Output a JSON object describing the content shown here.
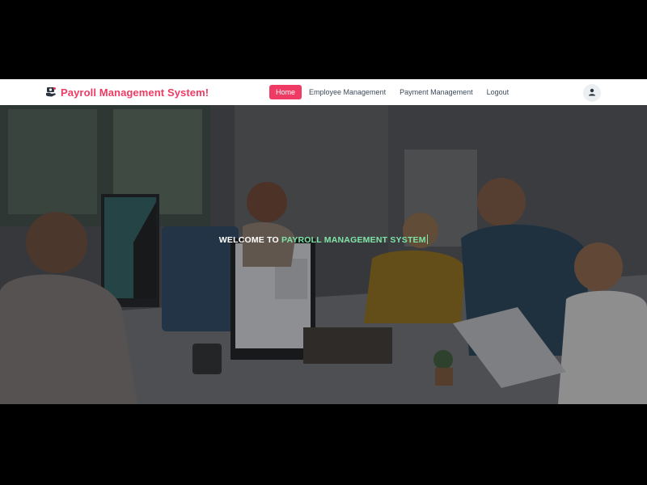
{
  "brand": {
    "title": "Payroll Management System!",
    "color": "#ef3b64",
    "icon": "hand-money-icon"
  },
  "nav": {
    "items": [
      {
        "label": "Home",
        "active": true
      },
      {
        "label": "Employee Management",
        "active": false
      },
      {
        "label": "Payment Management",
        "active": false
      },
      {
        "label": "Logout",
        "active": false
      }
    ]
  },
  "user_menu": {
    "icon": "user-icon"
  },
  "hero": {
    "welcome_prefix": "WELCOME TO ",
    "welcome_highlight": "PAYROLL MANAGEMENT SYSTEM",
    "highlight_color": "#7fe3a7",
    "background": "office-workers-photo"
  }
}
